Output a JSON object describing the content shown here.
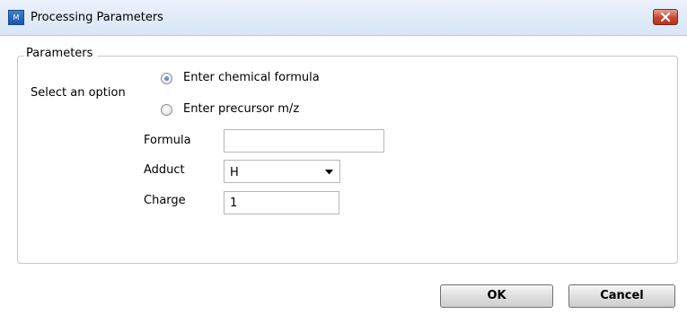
{
  "window": {
    "title": "Processing Parameters",
    "icon_text": "M",
    "close_icon": "close-icon"
  },
  "group": {
    "legend": "Parameters"
  },
  "form": {
    "select_option_label": "Select an option",
    "options": [
      {
        "label": "Enter chemical formula",
        "checked": true
      },
      {
        "label": "Enter precursor m/z",
        "checked": false
      }
    ],
    "formula_label": "Formula",
    "formula_value": "",
    "adduct_label": "Adduct",
    "adduct_value": "H",
    "charge_label": "Charge",
    "charge_value": "1"
  },
  "buttons": {
    "ok": "OK",
    "cancel": "Cancel"
  },
  "colors": {
    "title_bar": "#dce8f6",
    "close_button": "#c8452f",
    "radio_selected": "#1f5fbf"
  }
}
